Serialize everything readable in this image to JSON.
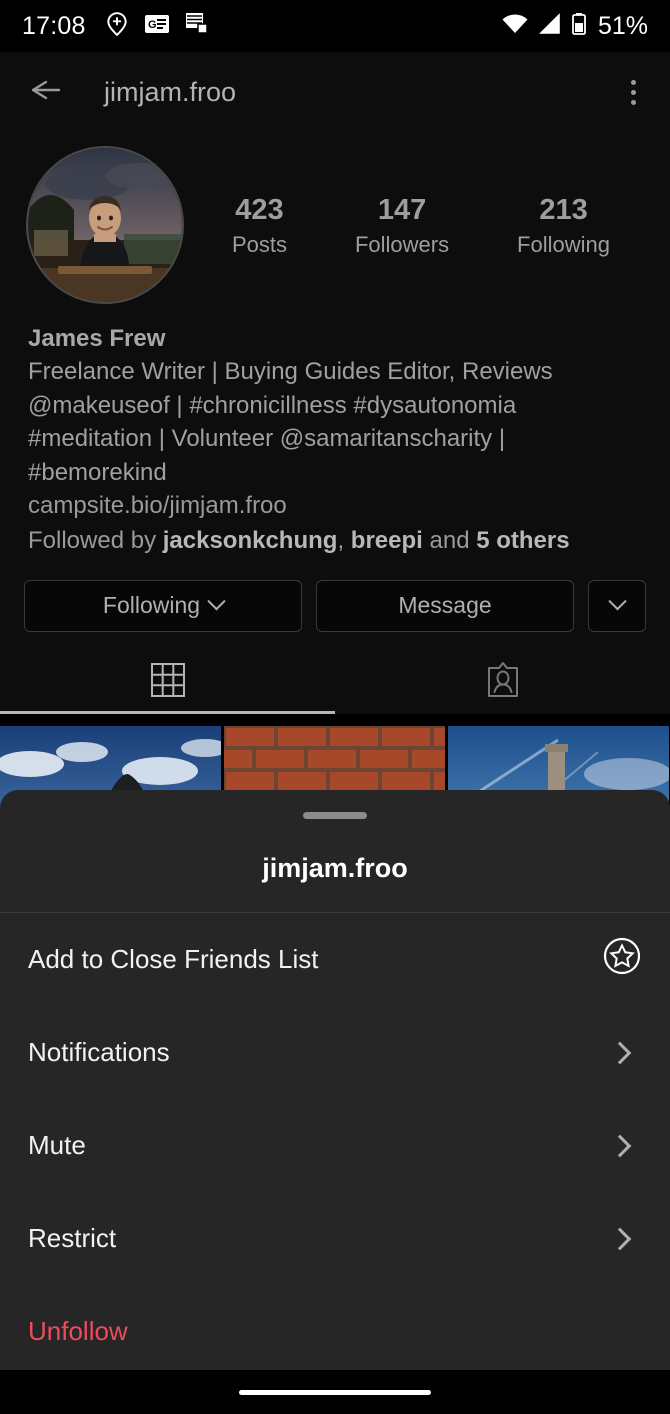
{
  "status_bar": {
    "time": "17:08",
    "battery_text": "51%",
    "icons": [
      "location-plus-icon",
      "google-news-icon",
      "documents-stack-icon",
      "wifi-icon",
      "cell-signal-icon",
      "battery-icon"
    ]
  },
  "app_bar": {
    "back_icon": "back-arrow-icon",
    "title": "jimjam.froo",
    "overflow_icon": "kebab-menu-icon"
  },
  "profile": {
    "avatar_alt": "profile-photo",
    "stats": [
      {
        "value": "423",
        "label": "Posts"
      },
      {
        "value": "147",
        "label": "Followers"
      },
      {
        "value": "213",
        "label": "Following"
      }
    ],
    "full_name": "James Frew",
    "bio_lines": [
      "Freelance Writer | Buying Guides Editor, Reviews",
      "@makeuseof | #chronicillness #dysautonomia",
      "#meditation | Volunteer @samaritanscharity |",
      "#bemorekind"
    ],
    "website": "campsite.bio/jimjam.froo",
    "followed_by": {
      "prefix": "Followed by ",
      "name1": "jacksonkchung",
      "sep1": ", ",
      "name2": "breepi",
      "sep2": " and ",
      "others": "5 others"
    },
    "buttons": {
      "following": "Following",
      "message": "Message",
      "more_icon": "chevron-down-icon"
    },
    "tabs": [
      {
        "name": "grid-tab",
        "icon": "grid-icon",
        "active": true
      },
      {
        "name": "tagged-tab",
        "icon": "tagged-person-icon",
        "active": false
      }
    ]
  },
  "grid": {
    "thumbnails": [
      {
        "name": "post-thumbnail-mountain",
        "description": "dark mountain peak against blue sky with clouds"
      },
      {
        "name": "post-thumbnail-brick-wall",
        "description": "red brick wall"
      },
      {
        "name": "post-thumbnail-chimney",
        "description": "stone chimney against blue sky with contrails"
      }
    ]
  },
  "sheet": {
    "handle": "drag-handle",
    "title": "jimjam.froo",
    "items": [
      {
        "name": "add-to-close-friends-item",
        "label": "Add to Close Friends List",
        "trailing": "circled-star-icon"
      },
      {
        "name": "notifications-item",
        "label": "Notifications",
        "trailing": "chevron-right-icon"
      },
      {
        "name": "mute-item",
        "label": "Mute",
        "trailing": "chevron-right-icon"
      },
      {
        "name": "restrict-item",
        "label": "Restrict",
        "trailing": "chevron-right-icon"
      },
      {
        "name": "unfollow-item",
        "label": "Unfollow",
        "trailing": "none"
      }
    ]
  },
  "nav_bar": {
    "pill": "gesture-home-pill"
  },
  "colors": {
    "background": "#000000",
    "surface": "#0d0d0d",
    "sheet": "#262626",
    "text_primary": "#f2f2f2",
    "text_secondary": "#9e9e9e",
    "danger": "#ed4c5c"
  }
}
